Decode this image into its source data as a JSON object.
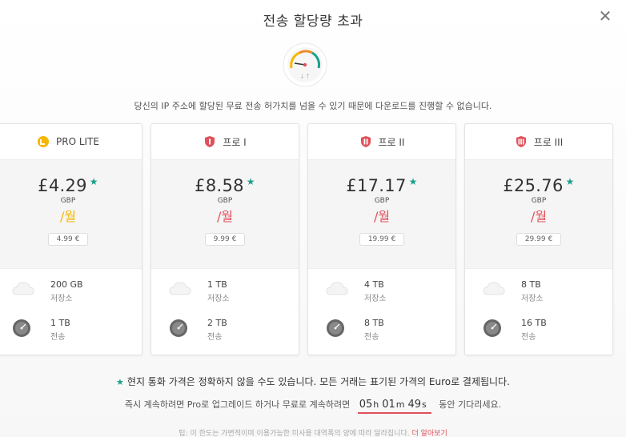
{
  "dialog": {
    "title": "전송 할당량 초과",
    "subtitle": "당신의 IP 주소에 할당된 무료 전송 허가치를 넘을 수 있기 때문에 다운로드를 진행할 수 없습니다."
  },
  "colors": {
    "accent_red": "#e0505b",
    "star_green": "#19a08a",
    "pro_lite": "#f5b800",
    "pro": "#e0505b"
  },
  "plans": [
    {
      "name": "PRO LITE",
      "price": "£4.29",
      "currency": "GBP",
      "per": "/월",
      "per_color": "#f5b800",
      "eur": "4.99 €",
      "storage": "200 GB",
      "storage_label": "저장소",
      "transfer": "1 TB",
      "transfer_label": "전송",
      "icon": "pro-lite-icon"
    },
    {
      "name": "프로 I",
      "price": "£8.58",
      "currency": "GBP",
      "per": "/월",
      "per_color": "#e0505b",
      "eur": "9.99 €",
      "storage": "1 TB",
      "storage_label": "저장소",
      "transfer": "2 TB",
      "transfer_label": "전송",
      "icon": "pro-i-icon"
    },
    {
      "name": "프로 II",
      "price": "£17.17",
      "currency": "GBP",
      "per": "/월",
      "per_color": "#e0505b",
      "eur": "19.99 €",
      "storage": "4 TB",
      "storage_label": "저장소",
      "transfer": "8 TB",
      "transfer_label": "전송",
      "icon": "pro-ii-icon"
    },
    {
      "name": "프로 III",
      "price": "£25.76",
      "currency": "GBP",
      "per": "/월",
      "per_color": "#e0505b",
      "eur": "29.99 €",
      "storage": "8 TB",
      "storage_label": "저장소",
      "transfer": "16 TB",
      "transfer_label": "전송",
      "icon": "pro-iii-icon"
    }
  ],
  "note": {
    "star": "★",
    "text": "현지 통화 가격은 정확하지 않을 수도 있습니다. 모든 거래는 표기된 가격의 Euro로 결제됩니다."
  },
  "wait": {
    "before": "즉시 계속하려면 Pro로 업그레이드 하거나 무료로 계속하려면",
    "hours": "05",
    "h": "h",
    "minutes": "01",
    "m": "m",
    "seconds": "49",
    "s": "s",
    "after": "동안 기다리세요."
  },
  "tip": {
    "text": "팁: 이 한도는 가변적이며 이용가능한 미사용 대역폭의 양에 따라 달라집니다.",
    "link": "더 알아보기"
  }
}
